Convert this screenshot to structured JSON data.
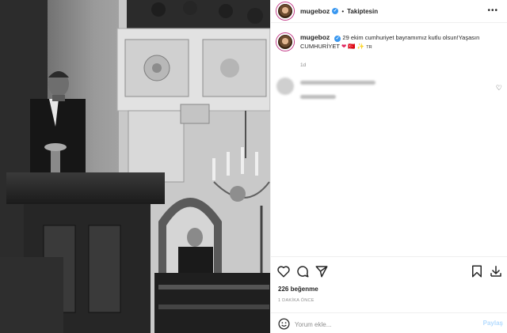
{
  "header": {
    "username": "mugeboz",
    "separator": "•",
    "follow_label": "Takiptesin",
    "more_icon": "more-horizontal-icon"
  },
  "caption": {
    "username": "mugeboz",
    "text": "29 ekim cumhuriyet bayramımız kutlu olsun!Yaşasın CUMHURİYET",
    "emoji_heart": "❤",
    "emoji_flag": "🇹🇷",
    "emoji_sparkle": "✨",
    "emoji_tr": "TR",
    "time": "1d"
  },
  "actions": {
    "likes": "226 beğenme",
    "posted_ago": "1 DAKİKA ÖNCE",
    "icons": [
      "heart-icon",
      "comment-icon",
      "share-icon",
      "bookmark-icon",
      "download-icon"
    ]
  },
  "comment_box": {
    "placeholder": "Yorum ekle...",
    "post_label": "Paylaş",
    "emoji_icon": "smiley-icon"
  },
  "colors": {
    "link_blue": "#3897f0",
    "post_disabled": "#b3dbff",
    "story_ring": "#c13584"
  }
}
